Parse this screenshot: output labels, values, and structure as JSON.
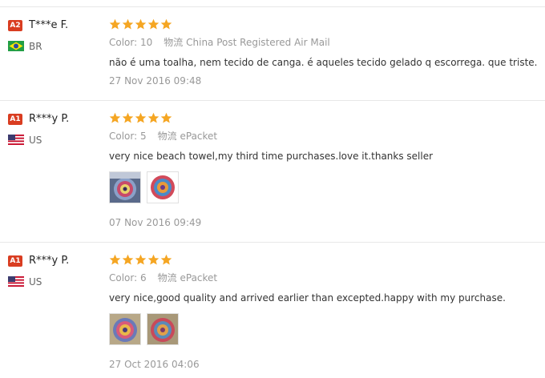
{
  "colors": {
    "star": "#f5a623",
    "badge_a2": "#d93d21",
    "badge_a1": "#d93d21"
  },
  "reviews": [
    {
      "badge": "A2",
      "name": "T***e F.",
      "country": "BR",
      "flag": "brazil-flag",
      "stars": 5,
      "color_label": "Color:",
      "color_value": "10",
      "ship_label": "物流",
      "ship_value": "China Post Registered Air Mail",
      "text": "não é uma toalha, nem tecido de canga. é aqueles tecido gelado q escorrega. que triste.",
      "date": "27 Nov 2016 09:48"
    },
    {
      "badge": "A1",
      "name": "R***y P.",
      "country": "US",
      "flag": "usa-flag",
      "stars": 5,
      "color_label": "Color:",
      "color_value": "5",
      "ship_label": "物流",
      "ship_value": "ePacket",
      "text": "very nice beach towel,my third time purchases.love it.thanks seller",
      "date": "07 Nov 2016 09:49"
    },
    {
      "badge": "A1",
      "name": "R***y P.",
      "country": "US",
      "flag": "usa-flag",
      "stars": 5,
      "color_label": "Color:",
      "color_value": "6",
      "ship_label": "物流",
      "ship_value": "ePacket",
      "text": "very nice,good quality and arrived earlier than excepted.happy with my purchase.",
      "date": "27 Oct 2016 04:06"
    }
  ]
}
